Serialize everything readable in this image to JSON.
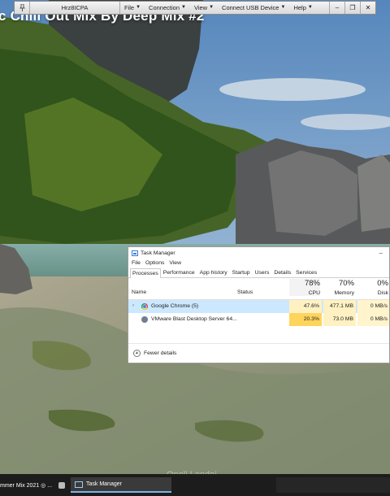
{
  "video": {
    "title": "c Chill Out Mix By Deep Mix #2",
    "caption": "Oneli   Lendai"
  },
  "toolbar": {
    "host": "Hrz8ICPA",
    "menus": [
      {
        "label": "File"
      },
      {
        "label": "Connection"
      },
      {
        "label": "View"
      },
      {
        "label": "Connect USB Device"
      },
      {
        "label": "Help"
      }
    ]
  },
  "task_manager": {
    "title": "Task Manager",
    "menu": [
      "File",
      "Options",
      "View"
    ],
    "tabs": [
      "Processes",
      "Performance",
      "App history",
      "Startup",
      "Users",
      "Details",
      "Services"
    ],
    "active_tab": "Processes",
    "columns": {
      "name": "Name",
      "status": "Status",
      "cpu": {
        "label": "CPU",
        "percent": "78%"
      },
      "memory": {
        "label": "Memory",
        "percent": "70%"
      },
      "disk": {
        "label": "Disk",
        "percent": "0%"
      }
    },
    "processes": [
      {
        "name": "Google Chrome (5)",
        "status": "",
        "cpu": "47.6%",
        "memory": "477.1 MB",
        "disk": "0 MB/s",
        "selected": true,
        "expandable": true,
        "icon": "chrome-icon"
      },
      {
        "name": "VMware Blast Desktop Server 64...",
        "status": "",
        "cpu": "20.3%",
        "memory": "73.0 MB",
        "disk": "0 MB/s",
        "selected": false,
        "expandable": false,
        "icon": "vmware-icon"
      }
    ],
    "footer": "Fewer details"
  },
  "taskbar": {
    "items": [
      {
        "label": "mmer Mix 2021 ◎ ..."
      },
      {
        "label": "Task Manager"
      }
    ]
  }
}
